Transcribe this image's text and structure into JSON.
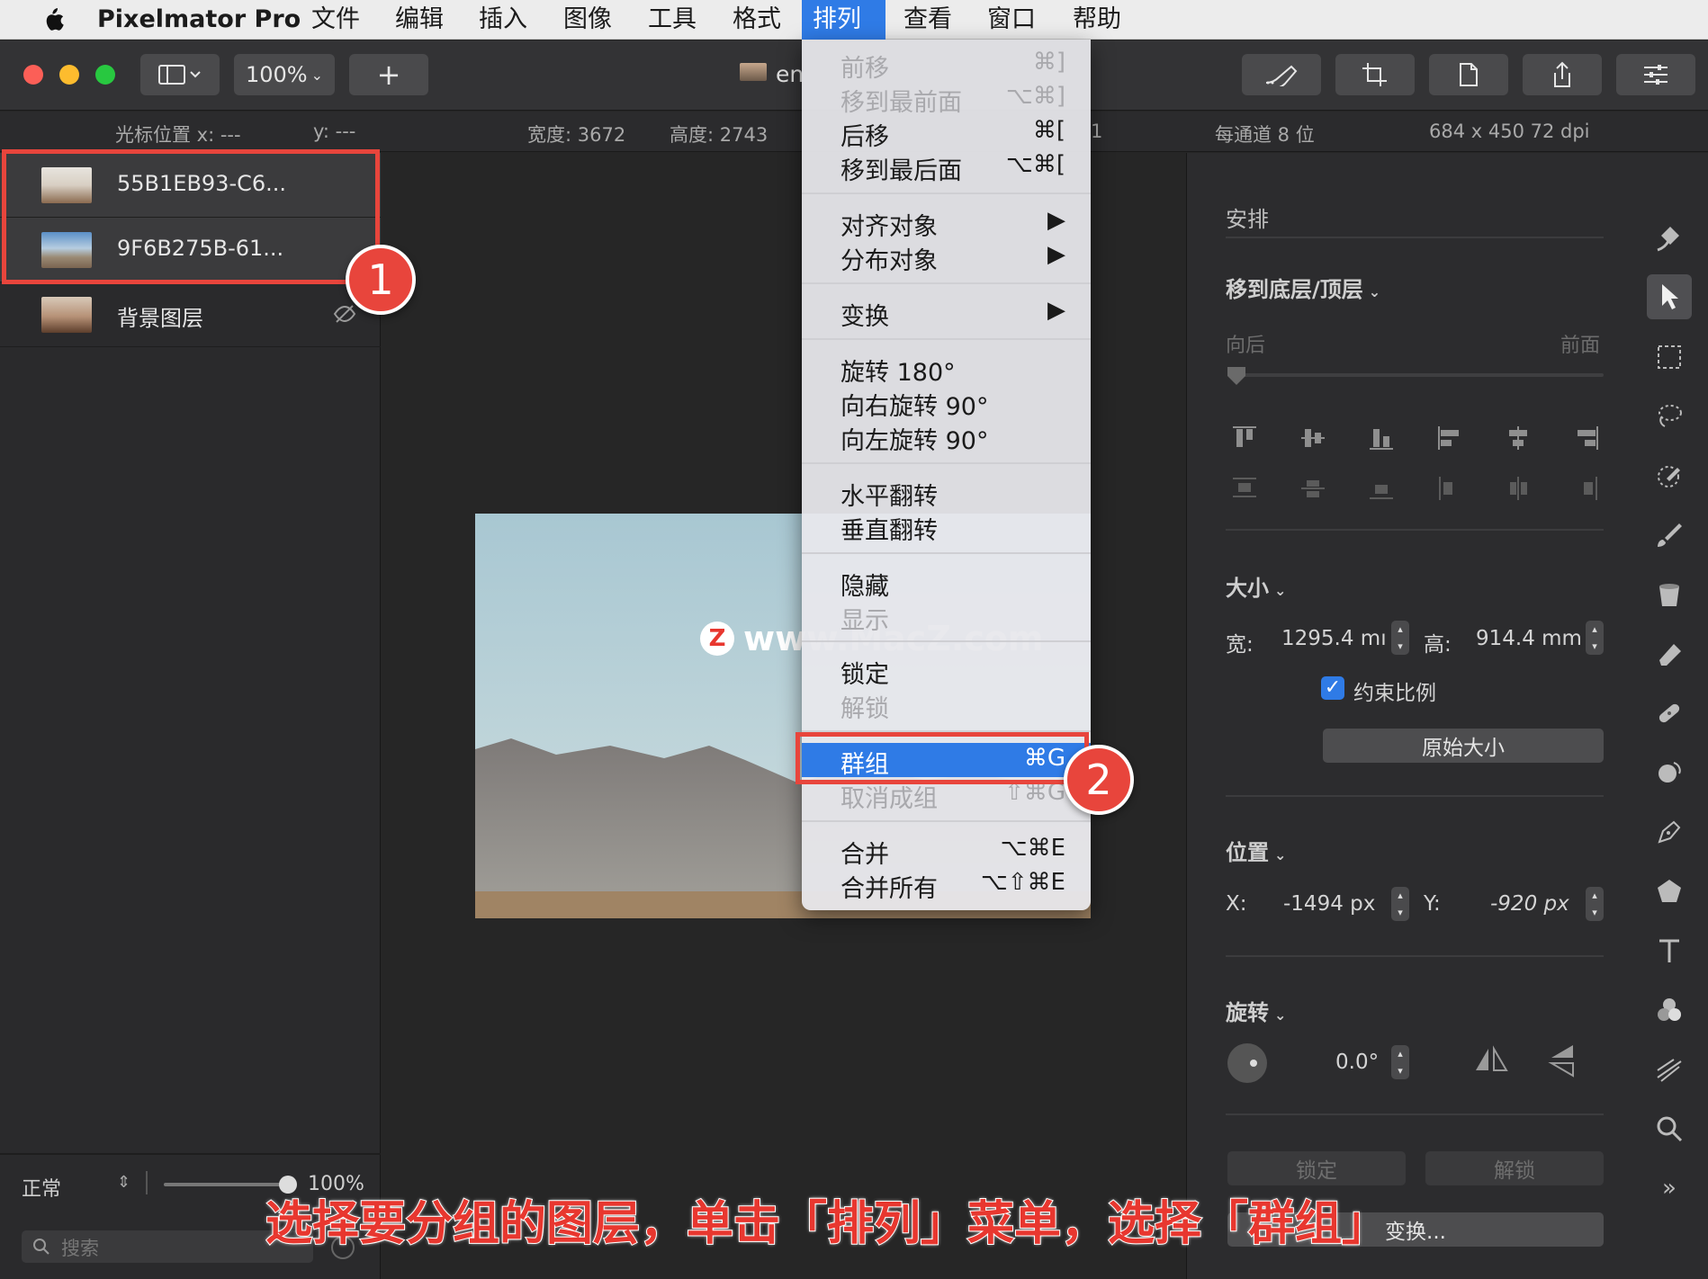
{
  "menubar": {
    "app_name": "Pixelmator Pro",
    "items": [
      "文件",
      "编辑",
      "插入",
      "图像",
      "工具",
      "格式",
      "排列",
      "查看",
      "窗口",
      "帮助"
    ],
    "active": "排列"
  },
  "toolbar": {
    "zoom": "100%",
    "add": "+",
    "doc_title": "en"
  },
  "infobar": {
    "cursor_x": "光标位置 x: ---",
    "cursor_y": "y: ---",
    "width": "宽度: 3672",
    "height": "高度: 2743",
    "partial": "1",
    "bits": "每通道 8 位",
    "resolution": "684 x 450 72 dpi"
  },
  "layers": [
    {
      "name": "55B1EB93-C6..."
    },
    {
      "name": "9F6B275B-61..."
    },
    {
      "name": "背景图层"
    }
  ],
  "layers_footer": {
    "blend_mode": "正常",
    "opacity": "100%",
    "opacity_value": 1.0,
    "search_placeholder": "搜索"
  },
  "arrange_menu": {
    "items": [
      {
        "label": "前移",
        "shortcut": "⌘]",
        "disabled": true
      },
      {
        "label": "移到最前面",
        "shortcut": "⌥⌘]",
        "disabled": true
      },
      {
        "label": "后移",
        "shortcut": "⌘[",
        "disabled": false
      },
      {
        "label": "移到最后面",
        "shortcut": "⌥⌘[",
        "disabled": false
      },
      {
        "label": "对齐对象",
        "shortcut": "▶",
        "disabled": false
      },
      {
        "label": "分布对象",
        "shortcut": "▶",
        "disabled": false
      },
      {
        "label": "变换",
        "shortcut": "▶",
        "disabled": false
      },
      {
        "label": "旋转 180°",
        "shortcut": "",
        "disabled": false
      },
      {
        "label": "向右旋转 90°",
        "shortcut": "",
        "disabled": false
      },
      {
        "label": "向左旋转 90°",
        "shortcut": "",
        "disabled": false
      },
      {
        "label": "水平翻转",
        "shortcut": "",
        "disabled": false
      },
      {
        "label": "垂直翻转",
        "shortcut": "",
        "disabled": false
      },
      {
        "label": "隐藏",
        "shortcut": "",
        "disabled": false
      },
      {
        "label": "显示",
        "shortcut": "",
        "disabled": true
      },
      {
        "label": "锁定",
        "shortcut": "",
        "disabled": false
      },
      {
        "label": "解锁",
        "shortcut": "",
        "disabled": true
      },
      {
        "label": "群组",
        "shortcut": "⌘G",
        "disabled": false,
        "highlighted": true
      },
      {
        "label": "取消成组",
        "shortcut": "⇧⌘G",
        "disabled": true
      },
      {
        "label": "合并",
        "shortcut": "⌥⌘E",
        "disabled": false
      },
      {
        "label": "合并所有",
        "shortcut": "⌥⇧⌘E",
        "disabled": false
      }
    ]
  },
  "right_panel": {
    "title": "安排",
    "order_section": "移到底层/顶层",
    "order_back": "向后",
    "order_front": "前面",
    "size_section": "大小",
    "width_label": "宽:",
    "width_value": "1295.4 mı",
    "height_label": "高:",
    "height_value": "914.4 mm",
    "constrain_label": "约束比例",
    "constrain_checked": true,
    "original_size_button": "原始大小",
    "position_section": "位置",
    "x_label": "X:",
    "x_value": "-1494 px",
    "y_label": "Y:",
    "y_value": "-920 px",
    "rotate_section": "旋转",
    "rotate_value": "0.0°",
    "lock_button": "锁定",
    "unlock_button": "解锁",
    "transform_button": "变换..."
  },
  "annotations": {
    "badge1": "1",
    "badge2": "2",
    "caption": "选择要分组的图层，单击「排列」菜单，选择「群组」",
    "watermark": "www.MacZ.com",
    "watermark_logo": "Z"
  },
  "colors": {
    "accent": "#2f7be6",
    "annotation_red": "#e8453c"
  }
}
